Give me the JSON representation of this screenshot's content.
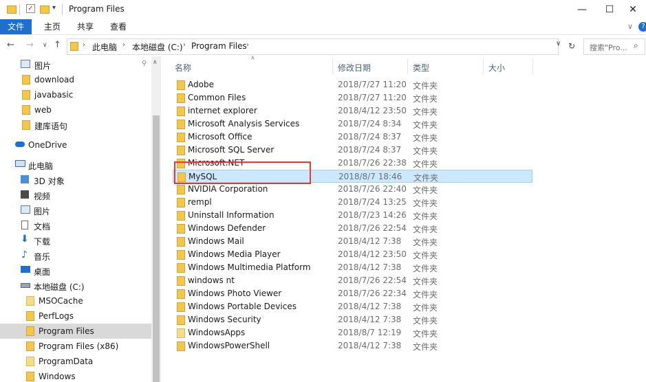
{
  "window": {
    "title": "Program Files",
    "minimize_glyph": "—",
    "maximize_glyph": "☐",
    "close_glyph": "✕"
  },
  "ribbon": {
    "tabs": [
      "文件",
      "主页",
      "共享",
      "查看"
    ],
    "expand_glyph": "∨",
    "help_glyph": "?"
  },
  "navigation": {
    "back_glyph": "←",
    "forward_glyph": "→",
    "recent_glyph": "∨",
    "up_glyph": "↑",
    "breadcrumbs": [
      "此电脑",
      "本地磁盘 (C:)",
      "Program Files"
    ],
    "refresh_glyph": "↻",
    "dropdown_glyph": "∨",
    "search_placeholder": "搜索\"Pro...",
    "search_icon": "search-icon"
  },
  "nav_pane": {
    "items": [
      {
        "label": "图片",
        "icon": "pictures-icon",
        "pinned": true
      },
      {
        "label": "download",
        "icon": "folder-icon"
      },
      {
        "label": "javabasic",
        "icon": "folder-icon"
      },
      {
        "label": "web",
        "icon": "folder-icon"
      },
      {
        "label": "建库语句",
        "icon": "folder-icon"
      },
      {
        "label": "OneDrive",
        "icon": "onedrive-icon"
      },
      {
        "label": "此电脑",
        "icon": "this-pc-icon"
      },
      {
        "label": "3D 对象",
        "icon": "3d-objects-icon"
      },
      {
        "label": "视频",
        "icon": "videos-icon"
      },
      {
        "label": "图片",
        "icon": "pictures-icon"
      },
      {
        "label": "文档",
        "icon": "documents-icon"
      },
      {
        "label": "下载",
        "icon": "downloads-icon"
      },
      {
        "label": "音乐",
        "icon": "music-icon"
      },
      {
        "label": "桌面",
        "icon": "desktop-icon"
      },
      {
        "label": "本地磁盘 (C:)",
        "icon": "drive-icon"
      },
      {
        "label": "MSOCache",
        "icon": "folder-icon"
      },
      {
        "label": "PerfLogs",
        "icon": "folder-icon"
      },
      {
        "label": "Program Files",
        "icon": "folder-icon",
        "selected": true
      },
      {
        "label": "Program Files (x86)",
        "icon": "folder-icon"
      },
      {
        "label": "ProgramData",
        "icon": "folder-icon"
      },
      {
        "label": "Windows",
        "icon": "folder-icon"
      }
    ],
    "pin_glyph": "📌",
    "collapse_glyph": "∧"
  },
  "columns": {
    "name": "名称",
    "modified": "修改日期",
    "type": "类型",
    "size": "大小"
  },
  "files": [
    {
      "name": "Adobe",
      "date": "2018/7/27 11:20",
      "type": "文件夹"
    },
    {
      "name": "Common Files",
      "date": "2018/7/27 11:20",
      "type": "文件夹"
    },
    {
      "name": "internet explorer",
      "date": "2018/4/12 23:50",
      "type": "文件夹"
    },
    {
      "name": "Microsoft Analysis Services",
      "date": "2018/7/24 8:34",
      "type": "文件夹"
    },
    {
      "name": "Microsoft Office",
      "date": "2018/7/24 8:37",
      "type": "文件夹"
    },
    {
      "name": "Microsoft SQL Server",
      "date": "2018/7/24 8:37",
      "type": "文件夹"
    },
    {
      "name": "Microsoft.NET",
      "date": "2018/7/26 22:38",
      "type": "文件夹"
    },
    {
      "name": "MySQL",
      "date": "2018/8/7 18:46",
      "type": "文件夹",
      "selected": true
    },
    {
      "name": "NVIDIA Corporation",
      "date": "2018/7/26 22:40",
      "type": "文件夹"
    },
    {
      "name": "rempl",
      "date": "2018/7/24 13:25",
      "type": "文件夹"
    },
    {
      "name": "Uninstall Information",
      "date": "2018/7/23 14:26",
      "type": "文件夹"
    },
    {
      "name": "Windows Defender",
      "date": "2018/7/26 22:54",
      "type": "文件夹"
    },
    {
      "name": "Windows Mail",
      "date": "2018/4/12 7:38",
      "type": "文件夹"
    },
    {
      "name": "Windows Media Player",
      "date": "2018/4/12 23:50",
      "type": "文件夹"
    },
    {
      "name": "Windows Multimedia Platform",
      "date": "2018/4/12 7:38",
      "type": "文件夹"
    },
    {
      "name": "windows nt",
      "date": "2018/7/26 22:54",
      "type": "文件夹"
    },
    {
      "name": "Windows Photo Viewer",
      "date": "2018/7/26 22:34",
      "type": "文件夹"
    },
    {
      "name": "Windows Portable Devices",
      "date": "2018/4/12 7:38",
      "type": "文件夹"
    },
    {
      "name": "Windows Security",
      "date": "2018/4/12 7:38",
      "type": "文件夹"
    },
    {
      "name": "WindowsApps",
      "date": "2018/8/7 12:19",
      "type": "文件夹"
    },
    {
      "name": "WindowsPowerShell",
      "date": "2018/4/12 7:38",
      "type": "文件夹"
    }
  ],
  "colors": {
    "accent": "#1e6fce",
    "selection": "#cce8ff",
    "highlight_box": "#e53935",
    "folder": "#f3c64c"
  }
}
